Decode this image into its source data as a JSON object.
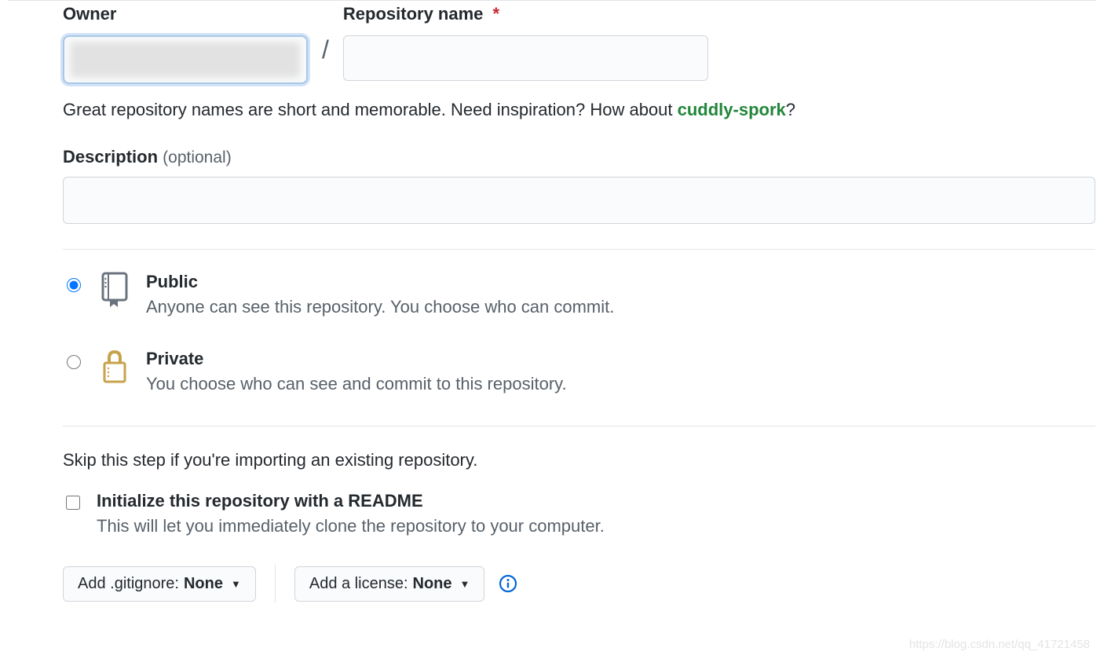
{
  "labels": {
    "owner": "Owner",
    "repo_name": "Repository name",
    "required_mark": "*",
    "description": "Description",
    "optional": "(optional)"
  },
  "helper": {
    "prefix": "Great repository names are short and memorable. Need inspiration? How about ",
    "suggestion": "cuddly-spork",
    "suffix": "?"
  },
  "visibility": {
    "public": {
      "title": "Public",
      "desc": "Anyone can see this repository. You choose who can commit."
    },
    "private": {
      "title": "Private",
      "desc": "You choose who can see and commit to this repository."
    }
  },
  "init": {
    "skip_text": "Skip this step if you're importing an existing repository.",
    "readme_title": "Initialize this repository with a README",
    "readme_desc": "This will let you immediately clone the repository to your computer."
  },
  "dropdowns": {
    "gitignore_label": "Add .gitignore: ",
    "gitignore_value": "None",
    "license_label": "Add a license: ",
    "license_value": "None"
  },
  "watermark": "https://blog.csdn.net/qq_41721458"
}
